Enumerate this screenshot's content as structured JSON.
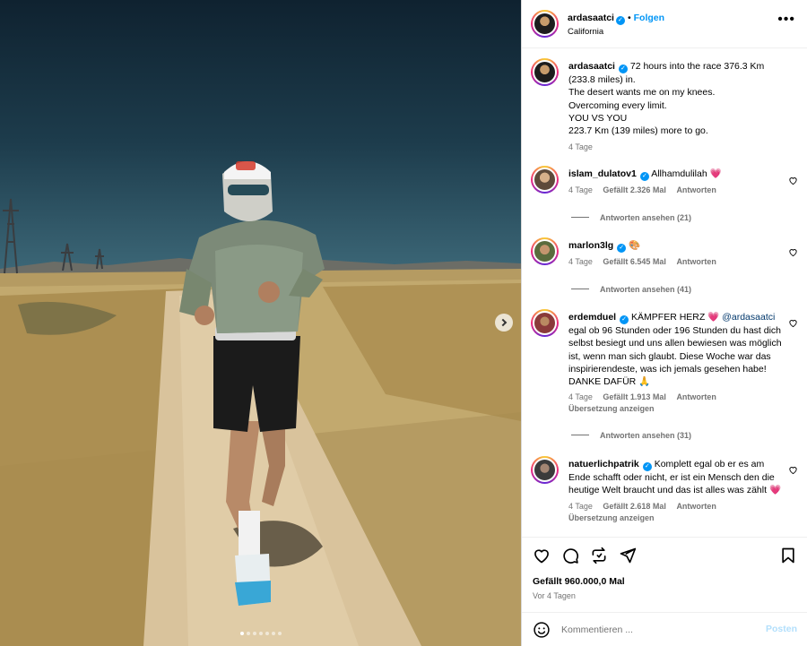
{
  "photo": {
    "alt_subject": "runner-on-desert-trail",
    "carousel_dots": 7,
    "active_dot": 0
  },
  "post": {
    "author": "ardasaatci",
    "follow_label": "Folgen",
    "location": "California",
    "caption": {
      "lines": [
        "72 hours into the race 376.3 Km (233.8 miles) in.",
        "The desert wants me on my knees.",
        "Overcoming every limit.",
        "YOU VS YOU",
        "223.7 Km (139 miles) more to go."
      ],
      "time": "4 Tage"
    }
  },
  "comments": [
    {
      "user": "islam_dulatov1",
      "text": "Allhamdulilah",
      "emoji": "💗",
      "time": "4 Tage",
      "likes": "Gefällt 2.326 Mal",
      "reply_label": "Antworten",
      "replies_label": "Antworten ansehen (21)"
    },
    {
      "user": "marlon3lg",
      "text": "",
      "emoji": "🎨",
      "time": "4 Tage",
      "likes": "Gefällt 6.545 Mal",
      "reply_label": "Antworten",
      "replies_label": "Antworten ansehen (41)"
    },
    {
      "user": "erdemduel",
      "text_before": "KÄMPFER HERZ",
      "heart": "💗",
      "mention": "@ardasaatci",
      "text_after": "egal ob 96 Stunden oder 196 Stunden du hast dich selbst besiegt und uns allen bewiesen was möglich ist, wenn man sich glaubt. Diese Woche war das inspirierendeste, was ich jemals gesehen habe! DANKE DAFÜR",
      "emoji_end": "🙏",
      "time": "4 Tage",
      "likes": "Gefällt 1.913 Mal",
      "reply_label": "Antworten",
      "translate_label": "Übersetzung anzeigen",
      "replies_label": "Antworten ansehen (31)"
    },
    {
      "user": "natuerlichpatrik",
      "text": "Komplett egal ob er es am Ende schafft oder nicht, er ist ein Mensch den die heutige Welt braucht und das ist alles was zählt",
      "emoji": "💗",
      "time": "4 Tage",
      "likes": "Gefällt 2.618 Mal",
      "reply_label": "Antworten",
      "translate_label": "Übersetzung anzeigen"
    }
  ],
  "actions": {
    "icons": [
      "heart-icon",
      "comment-icon",
      "repost-icon",
      "share-icon",
      "bookmark-icon"
    ],
    "likes_label": "Gefällt 960.000,0 Mal",
    "posted_ago": "Vor 4 Tagen"
  },
  "composer": {
    "placeholder": "Kommentieren ...",
    "value": "",
    "post_label": "Posten"
  },
  "colors": {
    "accent": "#0095f6",
    "muted": "#737373",
    "border": "#dbdbdb",
    "heart": "#e3265c",
    "post_disabled": "#b2dffc"
  }
}
